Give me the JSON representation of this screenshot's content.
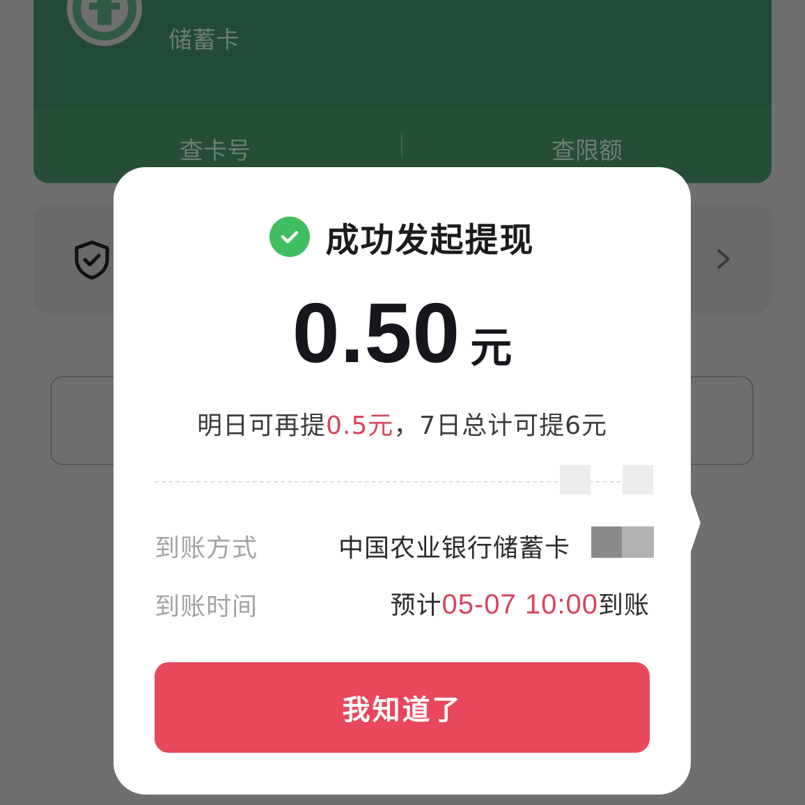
{
  "background": {
    "card_type": "储蓄卡",
    "actions": {
      "card_number": "查卡号",
      "limit": "查限额"
    }
  },
  "dialog": {
    "title": "成功发起提现",
    "amount": "0.50",
    "amount_unit": "元",
    "limit_note": {
      "prefix": "明日可再提",
      "tomorrow_amount": "0.5元",
      "suffix": "，7日总计可提6元"
    },
    "arrival_method": {
      "label": "到账方式",
      "value": "中国农业银行储蓄卡"
    },
    "arrival_time": {
      "label": "到账时间",
      "prefix": "预计",
      "datetime": "05-07 10:00",
      "suffix": "到账"
    },
    "confirm_label": "我知道了"
  },
  "colors": {
    "accent": "#e8475c",
    "highlight_text": "#d9435c",
    "success": "#3fbe62",
    "card_green": "#224a36"
  }
}
